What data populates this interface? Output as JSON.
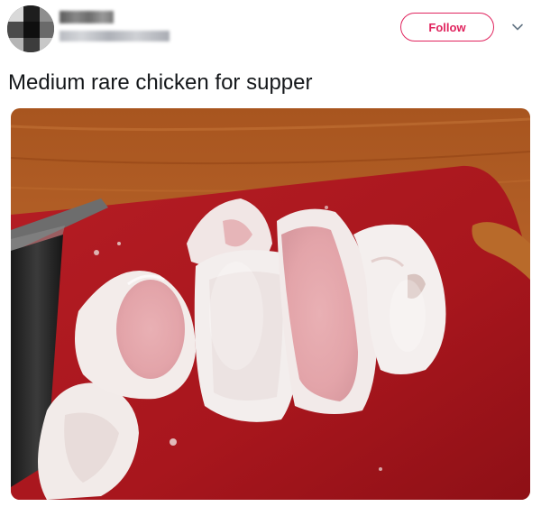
{
  "tweet": {
    "text": "Medium rare chicken for supper",
    "follow_label": "Follow",
    "icons": {
      "avatar": "avatar-blurred",
      "more": "chevron-down-icon"
    },
    "colors": {
      "accent": "#e0245e",
      "text": "#14171a"
    }
  }
}
